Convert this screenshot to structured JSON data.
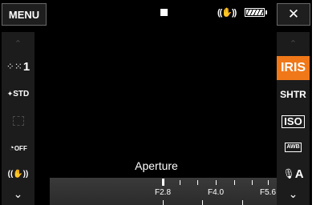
{
  "top_bar": {
    "menu_label": "MENU",
    "close_label": "✕",
    "stabilizer_glyph": "((✋))",
    "battery_level": 0.8
  },
  "left_column": {
    "up_glyph": "⌃",
    "items": [
      {
        "icon": "image-effect-icon",
        "label": "1"
      },
      {
        "icon": "look-std-icon",
        "label": "STD"
      },
      {
        "icon": "frame-icon",
        "label": ""
      },
      {
        "icon": "self-timer-off-icon",
        "label": "OFF"
      },
      {
        "icon": "image-stabilizer-icon",
        "label": "((✋))"
      }
    ],
    "down_glyph": "⌄"
  },
  "right_column": {
    "up_glyph": "⌃",
    "items": [
      {
        "label": "IRIS",
        "selected": true
      },
      {
        "label": "SHTR",
        "selected": false
      },
      {
        "label": "ISO",
        "selected": false
      },
      {
        "label": "AWB",
        "selected": false
      },
      {
        "label": "A",
        "icon": "mic-icon",
        "selected": false
      }
    ],
    "down_glyph": "⌄"
  },
  "aperture": {
    "label": "Aperture",
    "scale_values": [
      "F2.8",
      "F4.0",
      "F5.6"
    ],
    "current_value": "F2.8"
  },
  "colors": {
    "accent": "#f07818",
    "background": "#000000",
    "panel": "#1c1c1c"
  }
}
